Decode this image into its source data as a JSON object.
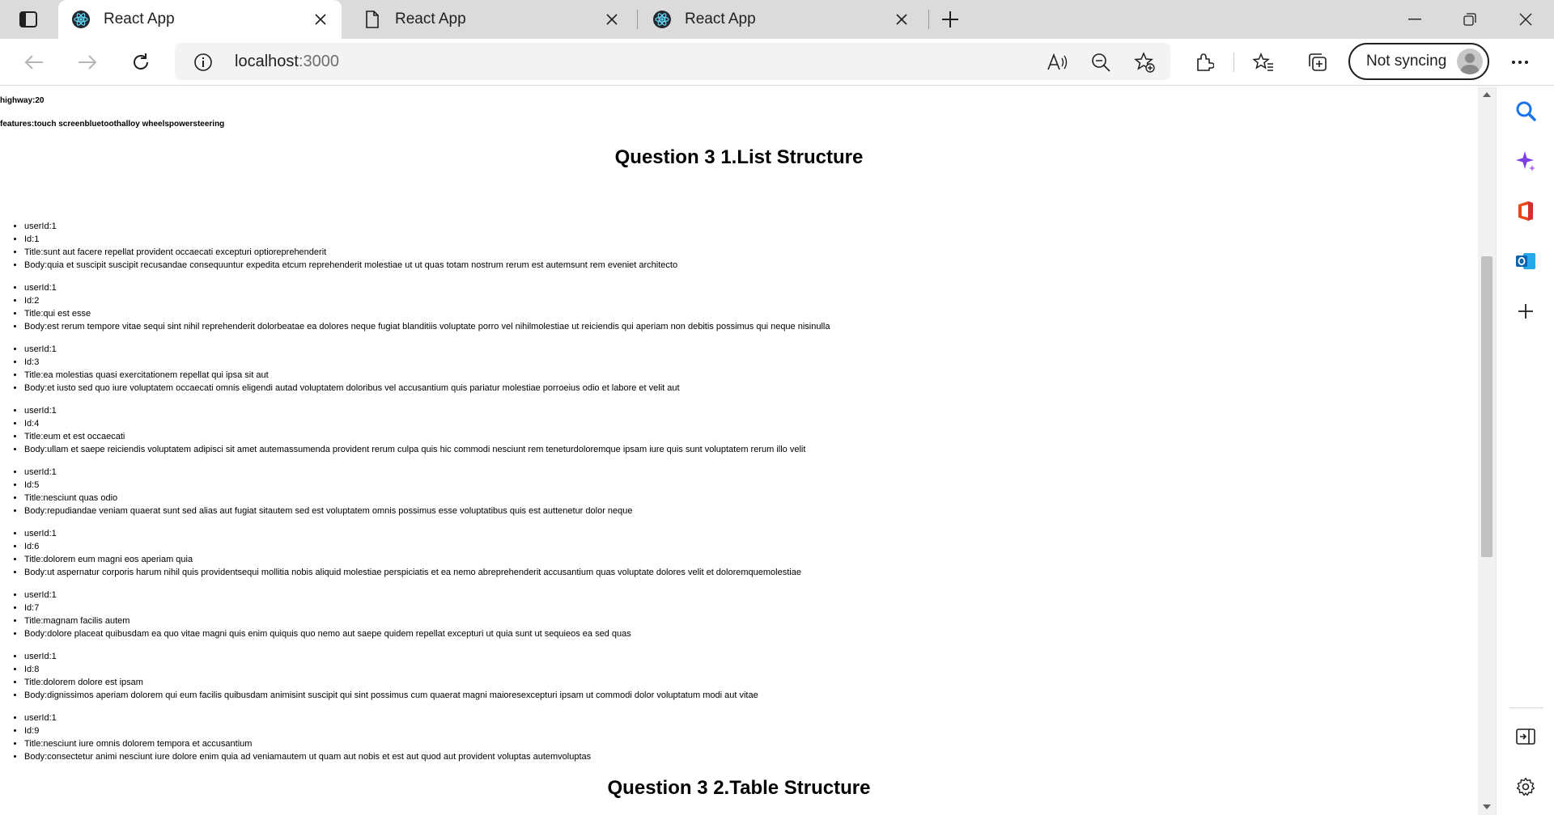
{
  "browser": {
    "tabs": [
      {
        "title": "React App",
        "icon": "react-icon",
        "active": true
      },
      {
        "title": "React App",
        "icon": "page-icon",
        "active": false
      },
      {
        "title": "React App",
        "icon": "react-icon",
        "active": false
      }
    ],
    "address": {
      "host": "localhost",
      "port": ":3000"
    },
    "sync_label": "Not syncing"
  },
  "page": {
    "meta": [
      {
        "label": "highway:20"
      },
      {
        "label": "features:touch screenbluetoothalloy wheelspowersteering"
      }
    ],
    "list_heading": "Question 3 1.List Structure",
    "table_heading": "Question 3 2.Table Structure",
    "posts": [
      {
        "userId": "userId:1",
        "id": "Id:1",
        "title": "Title:sunt aut facere repellat provident occaecati excepturi optioreprehenderit",
        "body": "Body:quia et suscipit suscipit recusandae consequuntur expedita etcum reprehenderit molestiae ut ut quas totam nostrum rerum est autemsunt rem eveniet architecto"
      },
      {
        "userId": "userId:1",
        "id": "Id:2",
        "title": "Title:qui est esse",
        "body": "Body:est rerum tempore vitae sequi sint nihil reprehenderit dolorbeatae ea dolores neque fugiat blanditiis voluptate porro vel nihilmolestiae ut reiciendis qui aperiam non debitis possimus qui neque nisinulla"
      },
      {
        "userId": "userId:1",
        "id": "Id:3",
        "title": "Title:ea molestias quasi exercitationem repellat qui ipsa sit aut",
        "body": "Body:et iusto sed quo iure voluptatem occaecati omnis eligendi autad voluptatem doloribus vel accusantium quis pariatur molestiae porroeius odio et labore et velit aut"
      },
      {
        "userId": "userId:1",
        "id": "Id:4",
        "title": "Title:eum et est occaecati",
        "body": "Body:ullam et saepe reiciendis voluptatem adipisci sit amet autemassumenda provident rerum culpa quis hic commodi nesciunt rem teneturdoloremque ipsam iure quis sunt voluptatem rerum illo velit"
      },
      {
        "userId": "userId:1",
        "id": "Id:5",
        "title": "Title:nesciunt quas odio",
        "body": "Body:repudiandae veniam quaerat sunt sed alias aut fugiat sitautem sed est voluptatem omnis possimus esse voluptatibus quis est auttenetur dolor neque"
      },
      {
        "userId": "userId:1",
        "id": "Id:6",
        "title": "Title:dolorem eum magni eos aperiam quia",
        "body": "Body:ut aspernatur corporis harum nihil quis providentsequi mollitia nobis aliquid molestiae perspiciatis et ea nemo abreprehenderit accusantium quas voluptate dolores velit et doloremquemolestiae"
      },
      {
        "userId": "userId:1",
        "id": "Id:7",
        "title": "Title:magnam facilis autem",
        "body": "Body:dolore placeat quibusdam ea quo vitae magni quis enim quiquis quo nemo aut saepe quidem repellat excepturi ut quia sunt ut sequieos ea sed quas"
      },
      {
        "userId": "userId:1",
        "id": "Id:8",
        "title": "Title:dolorem dolore est ipsam",
        "body": "Body:dignissimos aperiam dolorem qui eum facilis quibusdam animisint suscipit qui sint possimus cum quaerat magni maioresexcepturi ipsam ut commodi dolor voluptatum modi aut vitae"
      },
      {
        "userId": "userId:1",
        "id": "Id:9",
        "title": "Title:nesciunt iure omnis dolorem tempora et accusantium",
        "body": "Body:consectetur animi nesciunt iure dolore enim quia ad veniamautem ut quam aut nobis et est aut quod aut provident voluptas autemvoluptas"
      }
    ]
  },
  "sidebar": {
    "items": [
      {
        "icon": "search-icon"
      },
      {
        "icon": "copilot-icon"
      },
      {
        "icon": "office-icon"
      },
      {
        "icon": "outlook-icon"
      },
      {
        "icon": "add-icon"
      }
    ]
  }
}
